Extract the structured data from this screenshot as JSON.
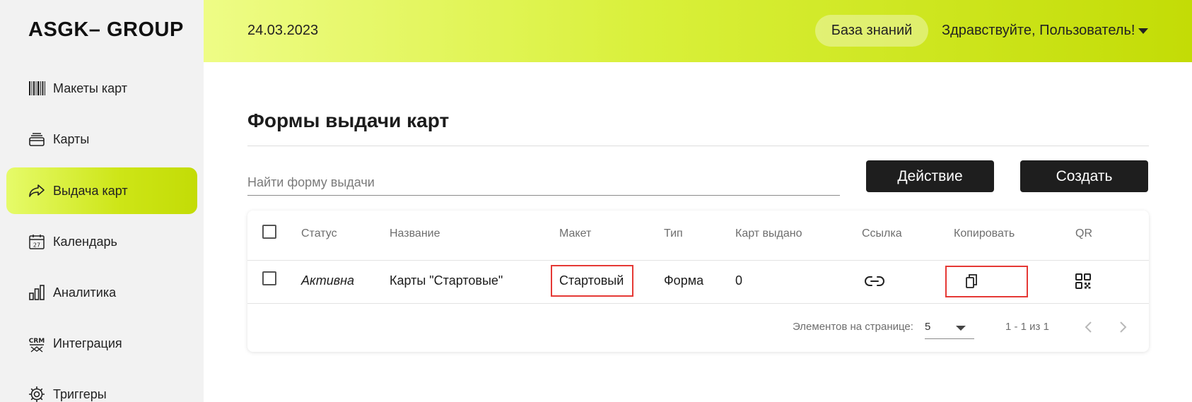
{
  "app": {
    "logo": "ASGK– GROUP"
  },
  "sidebar": {
    "items": [
      {
        "label": "Макеты карт",
        "icon": "barcode-icon"
      },
      {
        "label": "Карты",
        "icon": "cards-stack-icon"
      },
      {
        "label": "Выдача карт",
        "icon": "share-arrow-icon",
        "active": true
      },
      {
        "label": "Календарь",
        "icon": "calendar-icon"
      },
      {
        "label": "Аналитика",
        "icon": "bar-chart-icon"
      },
      {
        "label": "Интеграция",
        "icon": "crm-icon"
      },
      {
        "label": "Триггеры",
        "icon": "gear-icon"
      }
    ]
  },
  "header": {
    "date": "24.03.2023",
    "knowledge_base": "База знаний",
    "greeting": "Здравствуйте, Пользователь!"
  },
  "page": {
    "title": "Формы выдачи карт",
    "search_placeholder": "Найти форму выдачи",
    "action_button": "Действие",
    "create_button": "Создать"
  },
  "table": {
    "columns": [
      "Статус",
      "Название",
      "Макет",
      "Тип",
      "Карт выдано",
      "Ссылка",
      "Копировать",
      "QR"
    ],
    "rows": [
      {
        "status": "Активна",
        "name": "Карты \"Стартовые\"",
        "layout": "Стартовый",
        "type": "Форма",
        "issued": "0",
        "link_icon": "link-icon",
        "copy_icon": "copy-icon",
        "qr_icon": "qr-code-icon"
      }
    ]
  },
  "pagination": {
    "label": "Элементов на странице:",
    "page_size": "5",
    "range": "1 - 1 из 1"
  },
  "colors": {
    "accent": "#c3dc06",
    "accent_light": "#eefc86",
    "dark_button": "#1e1e1e",
    "highlight": "#e53935"
  }
}
